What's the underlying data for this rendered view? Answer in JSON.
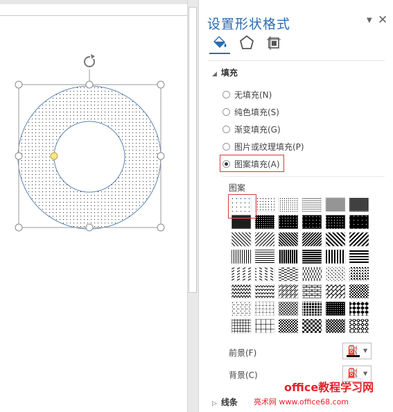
{
  "pane": {
    "title": "设置形状格式",
    "tabs": [
      {
        "name": "fill-line",
        "icon": "paint-bucket-icon",
        "active": true
      },
      {
        "name": "effects",
        "icon": "pentagon-icon",
        "active": false
      },
      {
        "name": "size-properties",
        "icon": "size-layout-icon",
        "active": false
      }
    ]
  },
  "fill_section": {
    "heading": "填充",
    "options": [
      {
        "label": "无填充(N)",
        "checked": false
      },
      {
        "label": "纯色填充(S)",
        "checked": false
      },
      {
        "label": "渐变填充(G)",
        "checked": false
      },
      {
        "label": "图片或纹理填充(P)",
        "checked": false
      },
      {
        "label": "图案填充(A)",
        "checked": true
      }
    ],
    "pattern_label": "图案",
    "pattern_selected_index": 0,
    "foreground_label": "前景(F)",
    "background_label": "背景(C)",
    "foreground_color": "#000000",
    "background_color": "#ffffff"
  },
  "line_section": {
    "heading": "线条"
  },
  "watermark": {
    "line1": "office教程学习网",
    "line2": "亮术网  www.office68.com"
  },
  "colors": {
    "accent": "#2c6cb0",
    "highlight": "#d43a3a",
    "shape_outline": "#5b84b1",
    "handle_yellow": "#f6e58d"
  }
}
